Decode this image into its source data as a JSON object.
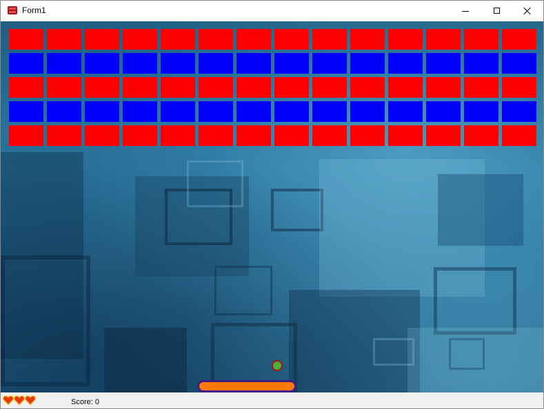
{
  "window": {
    "title": "Form1"
  },
  "icons": {
    "app": "form-app-icon",
    "minimize": "minimize-icon",
    "maximize": "maximize-icon",
    "close": "close-icon",
    "life": "heart-icon"
  },
  "game": {
    "brick_rows": [
      {
        "color": "#ff0000",
        "count": 14
      },
      {
        "color": "#0000ff",
        "count": 14
      },
      {
        "color": "#ff0000",
        "count": 14
      },
      {
        "color": "#0000ff",
        "count": 14
      },
      {
        "color": "#ff0000",
        "count": 14
      }
    ],
    "ball_color": "#4caf3c",
    "ball_border_color": "#b01010",
    "paddle_color": "#ff7a00",
    "paddle_border_color": "#3d1c8c"
  },
  "status": {
    "lives": 3,
    "score_text": "Score: 0"
  }
}
